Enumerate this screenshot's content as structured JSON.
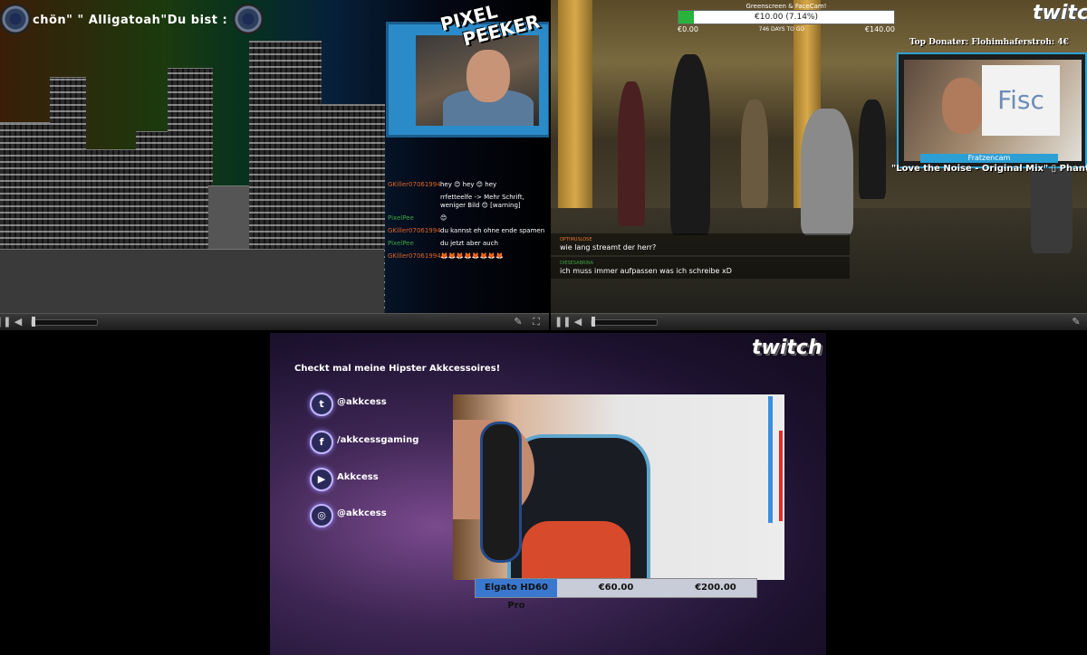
{
  "player1": {
    "marquee": "chön\"  \"  Alligatoah\"Du bist :",
    "logo_line1": "PIXEL",
    "logo_line2": "PEEKER",
    "chat": [
      {
        "user": "GKiller07061994",
        "msg": "hey 😊 hey 😊 hey",
        "color": "orange"
      },
      {
        "user": "",
        "msg": "rrfetteelfe -> Mehr Schrift, weniger Bild 😊 [warning]",
        "color": "green"
      },
      {
        "user": "PixelPee",
        "msg": "😊",
        "color": "green"
      },
      {
        "user": "GKiller07061994",
        "msg": "du kannst eh ohne ende spamen",
        "color": "orange"
      },
      {
        "user": "PixelPee",
        "msg": "du jetzt aber auch",
        "color": "green"
      },
      {
        "user": "GKiller07061994",
        "msg": "🦊🦊🦊🦊🦊🦊🦊🦊",
        "color": "orange"
      }
    ]
  },
  "player2": {
    "goal_title": "Greenscreen & FaceCam!",
    "goal_progress": "€10.00 (7.14%)",
    "goal_fraction": 0.0714,
    "goal_start": "€0.00",
    "goal_days": "746 DAYS TO GO",
    "goal_end": "€140.00",
    "twitch": "twitch",
    "top_donator": "Top Donater: Flohimhaferstroh: 4€",
    "cam_card": "Fisc",
    "cam_label": "Fratzencam",
    "song": "\"Love the Noise - Original Mix\" ▯ Phanta",
    "chat": [
      {
        "user": "OPTIMUSLOSE",
        "msg": "wie lang streamt der herr?",
        "color": "orange"
      },
      {
        "user": "DIESESABRINA",
        "msg": "ich muss immer aufpassen was ich schreibe xD",
        "color": "green"
      }
    ]
  },
  "player3": {
    "twitch": "twitch",
    "headline": "Checkt mal meine Hipster Akkcessoires!",
    "socials": [
      {
        "icon": "twitter-icon",
        "glyph": "t",
        "label": "@akkcess"
      },
      {
        "icon": "facebook-icon",
        "glyph": "f",
        "label": "/akkcessgaming"
      },
      {
        "icon": "youtube-icon",
        "glyph": "▶",
        "label": "Akkcess"
      },
      {
        "icon": "instagram-icon",
        "glyph": "◎",
        "label": "@akkcess"
      }
    ],
    "bar_label": "Elgato HD60 Pro",
    "bar_current": "€60.00",
    "bar_goal": "€200.00"
  },
  "colors": {
    "accent": "#2ca0d4",
    "goal_fill": "#28b43c",
    "orange": "#e0642b",
    "green": "#3fa142"
  }
}
